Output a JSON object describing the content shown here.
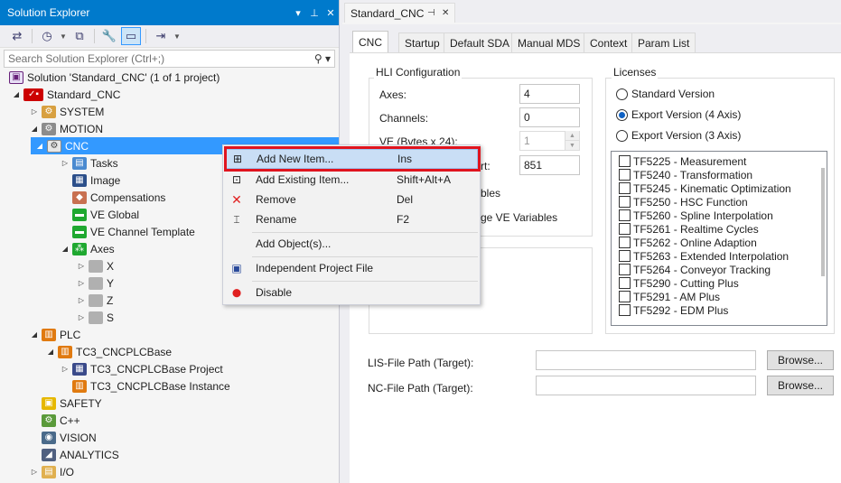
{
  "solution_explorer": {
    "title": "Solution Explorer",
    "title_controls": [
      "▾",
      "⊥",
      "✕"
    ],
    "search_placeholder": "Search Solution Explorer (Ctrl+;)",
    "tree": [
      {
        "label": "Solution 'Standard_CNC' (1 of 1 project)",
        "icon": "solution-icon"
      },
      {
        "label": "Standard_CNC",
        "icon": "twincat-project-icon"
      },
      {
        "label": "SYSTEM",
        "icon": "system-icon"
      },
      {
        "label": "MOTION",
        "icon": "motion-icon"
      },
      {
        "label": "CNC",
        "icon": "cnc-icon"
      },
      {
        "label": "Tasks",
        "icon": "tasks-icon"
      },
      {
        "label": "Image",
        "icon": "image-icon"
      },
      {
        "label": "Compensations",
        "icon": "compensations-icon"
      },
      {
        "label": "VE Global",
        "icon": "ve-global-icon"
      },
      {
        "label": "VE Channel Template",
        "icon": "ve-channel-icon"
      },
      {
        "label": "Axes",
        "icon": "axes-icon"
      },
      {
        "label": "X",
        "icon": "axis-icon"
      },
      {
        "label": "Y",
        "icon": "axis-icon"
      },
      {
        "label": "Z",
        "icon": "axis-icon"
      },
      {
        "label": "S",
        "icon": "axis-icon"
      },
      {
        "label": "PLC",
        "icon": "plc-icon"
      },
      {
        "label": "TC3_CNCPLCBase",
        "icon": "plc-project-icon"
      },
      {
        "label": "TC3_CNCPLCBase Project",
        "icon": "plc-subproject-icon"
      },
      {
        "label": "TC3_CNCPLCBase Instance",
        "icon": "plc-instance-icon"
      },
      {
        "label": "SAFETY",
        "icon": "safety-icon"
      },
      {
        "label": "C++",
        "icon": "cpp-icon"
      },
      {
        "label": "VISION",
        "icon": "vision-icon"
      },
      {
        "label": "ANALYTICS",
        "icon": "analytics-icon"
      },
      {
        "label": "I/O",
        "icon": "io-icon"
      }
    ]
  },
  "context_menu": {
    "items": [
      {
        "label": "Add New Item...",
        "shortcut": "Ins",
        "icon": "add-new-item-icon"
      },
      {
        "label": "Add Existing Item...",
        "shortcut": "Shift+Alt+A",
        "icon": "add-existing-item-icon"
      },
      {
        "label": "Remove",
        "shortcut": "Del",
        "icon": "remove-icon"
      },
      {
        "label": "Rename",
        "shortcut": "F2",
        "icon": "rename-icon"
      },
      {
        "label": "Add Object(s)...",
        "shortcut": "",
        "icon": ""
      },
      {
        "label": "Independent Project File",
        "shortcut": "",
        "icon": "save-icon"
      },
      {
        "label": "Disable",
        "shortcut": "",
        "icon": "disable-icon"
      }
    ]
  },
  "document": {
    "tab_title": "Standard_CNC",
    "tabs": [
      "CNC",
      "Startup",
      "Default SDA",
      "Manual MDS",
      "Context",
      "Param List"
    ],
    "hli": {
      "title": "HLI Configuration",
      "axes_label": "Axes:",
      "axes_value": "4",
      "channels_label": "Channels:",
      "channels_value": "0",
      "ve_label": "VE (Bytes x 24):",
      "ve_value": "1",
      "port_label_fragment": "rt:",
      "port_value": "851",
      "opt1_fragment": "bles",
      "opt2_fragment": "ge VE Variables"
    },
    "licenses": {
      "title": "Licenses",
      "radios": [
        {
          "label": "Standard Version",
          "checked": false
        },
        {
          "label": "Export Version (4 Axis)",
          "checked": true
        },
        {
          "label": "Export Version (3 Axis)",
          "checked": false
        }
      ],
      "checks": [
        "TF5225 - Measurement",
        "TF5240 - Transformation",
        "TF5245 - Kinematic Optimization",
        "TF5250 - HSC Function",
        "TF5260 - Spline Interpolation",
        "TF5261 - Realtime Cycles",
        "TF5262 - Online Adaption",
        "TF5263 - Extended Interpolation",
        "TF5264 - Conveyor Tracking",
        "TF5290 - Cutting Plus",
        "TF5291 - AM Plus",
        "TF5292 - EDM Plus"
      ]
    },
    "lis_label": "LIS-File Path (Target):",
    "nc_label": "NC-File Path (Target):",
    "browse_label": "Browse..."
  }
}
